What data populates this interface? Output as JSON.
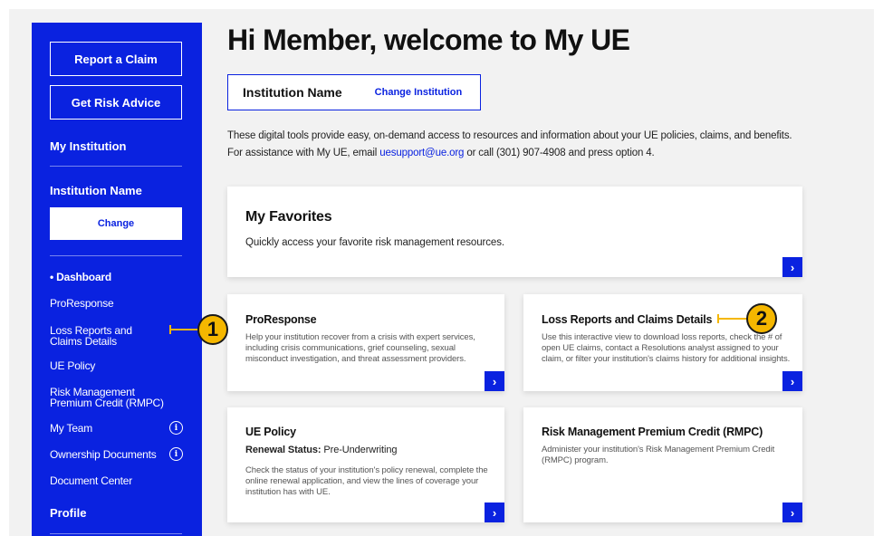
{
  "sidebar": {
    "report_claim": "Report a Claim",
    "get_risk_advice": "Get Risk Advice",
    "my_institution": "My Institution",
    "institution_name": "Institution Name",
    "change": "Change",
    "nav": [
      {
        "label": "• Dashboard",
        "active": true
      },
      {
        "label": "ProResponse"
      },
      {
        "label": "Loss Reports and Claims Details"
      },
      {
        "label": "UE Policy"
      },
      {
        "label": "Risk Management Premium Credit (RMPC)"
      },
      {
        "label": "My Team",
        "info": true
      },
      {
        "label": "Ownership Documents",
        "info": true
      },
      {
        "label": "Document Center"
      }
    ],
    "profile": "Profile",
    "info_glyph": "i"
  },
  "main": {
    "title": "Hi Member, welcome to My UE",
    "institution_name": "Institution Name",
    "change_institution": "Change Institution",
    "intro_line1": "These digital tools provide easy, on-demand access to resources and information about your UE policies, claims, and benefits.",
    "intro_line2_pre": "For assistance with My UE, email ",
    "intro_email": "uesupport@ue.org",
    "intro_line2_post": " or call (301) 907-4908 and press option 4."
  },
  "favorites": {
    "title": "My Favorites",
    "text": "Quickly access your favorite risk management resources."
  },
  "cards": {
    "proresponse": {
      "title": "ProResponse",
      "text": "Help your institution recover from a crisis with expert services, including crisis communications, grief counseling, sexual misconduct investigation, and threat assessment providers."
    },
    "loss_reports": {
      "title": "Loss Reports and Claims Details",
      "text": "Use this interactive view to download loss reports, check the # of open UE claims, contact a Resolutions analyst assigned to your claim, or filter your institution's claims history for additional insights."
    },
    "ue_policy": {
      "title": "UE Policy",
      "renewal_label": "Renewal Status:",
      "renewal_value": " Pre-Underwriting",
      "text": "Check the status of your institution's policy renewal, complete the online renewal application, and view the lines of coverage your institution has with UE."
    },
    "rmpc": {
      "title": "Risk Management Premium Credit (RMPC)",
      "text": "Administer your institution's Risk Management Premium Credit (RMPC) program."
    }
  },
  "arrow_glyph": "›",
  "callouts": [
    "1",
    "2"
  ],
  "colors": {
    "brand_blue": "#0a22e0",
    "callout_yellow": "#f5b700"
  }
}
